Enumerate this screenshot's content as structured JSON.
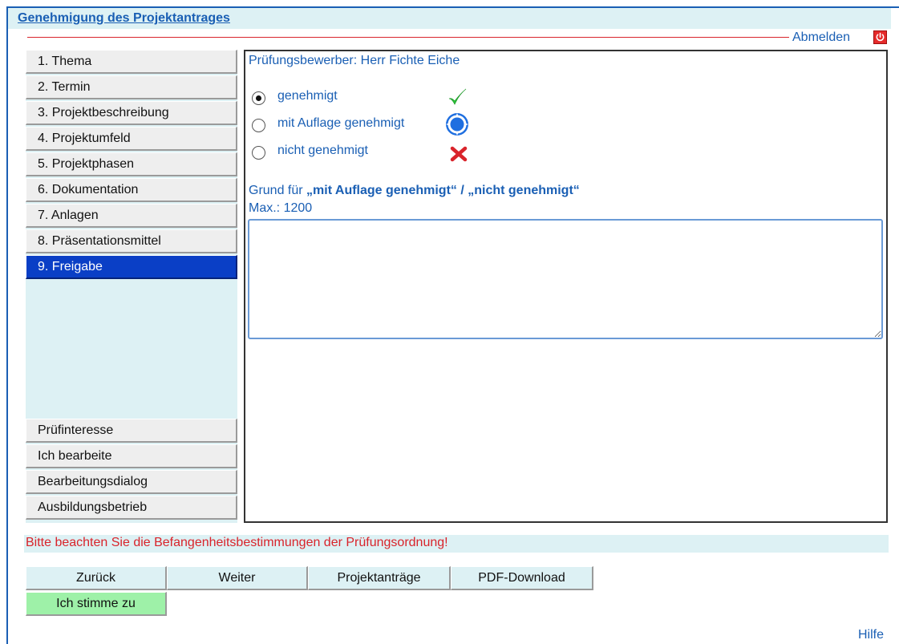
{
  "app": {
    "title": "Genehmigung des Projektantrages",
    "logout_label": "Abmelden"
  },
  "sidebar": {
    "items": [
      {
        "label": "1. Thema"
      },
      {
        "label": "2. Termin"
      },
      {
        "label": "3. Projektbeschreibung"
      },
      {
        "label": "4. Projektumfeld"
      },
      {
        "label": "5. Projektphasen"
      },
      {
        "label": "6. Dokumentation"
      },
      {
        "label": "7. Anlagen"
      },
      {
        "label": "8. Präsentationsmittel"
      },
      {
        "label": "9. Freigabe",
        "active": true
      }
    ],
    "bottom_items": [
      {
        "label": "Prüfinteresse"
      },
      {
        "label": "Ich bearbeite"
      },
      {
        "label": "Bearbeitungsdialog"
      },
      {
        "label": "Ausbildungsbetrieb"
      }
    ]
  },
  "main": {
    "applicant_text": "Prüfungsbewerber: Herr Fichte Eiche",
    "options": [
      {
        "label": "genehmigt",
        "checked": true,
        "icon": "checkmark-icon"
      },
      {
        "label": "mit Auflage genehmigt",
        "checked": false,
        "icon": "conditional-icon"
      },
      {
        "label": "nicht genehmigt",
        "checked": false,
        "icon": "cross-icon"
      }
    ],
    "reason": {
      "prefix": "Grund für ",
      "bold_text": "„mit Auflage genehmigt“ / „nicht genehmigt“",
      "max_text": "Max.: 1200",
      "value": ""
    }
  },
  "notice": "Bitte beachten Sie die Befangenheitsbestimmungen der Prüfungsordnung!",
  "actions": {
    "back": "Zurück",
    "next": "Weiter",
    "projects": "Projektanträge",
    "pdf": "PDF-Download",
    "agree": "Ich stimme zu"
  },
  "help_label": "Hilfe",
  "colors": {
    "accent_blue": "#1a5fb4",
    "active_nav": "#0a3fc6",
    "panel_bg": "#ddf1f4",
    "warning_red": "#d9242b",
    "agree_green": "#9ef1a8"
  }
}
